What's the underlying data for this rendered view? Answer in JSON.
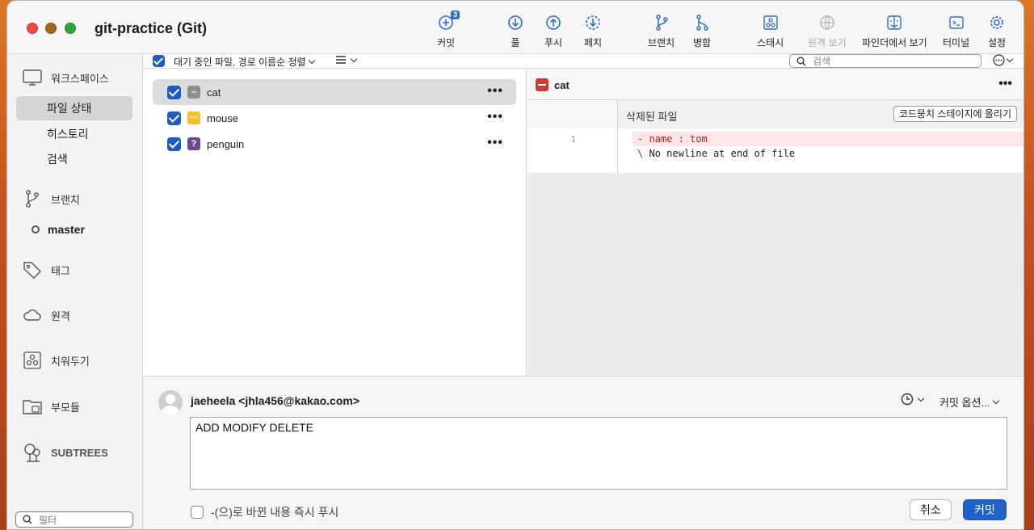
{
  "window": {
    "title": "git-practice (Git)"
  },
  "toolbar": {
    "commit": {
      "label": "커밋",
      "badge": "3"
    },
    "pull": {
      "label": "풀"
    },
    "push": {
      "label": "푸시"
    },
    "fetch": {
      "label": "페치"
    },
    "branch": {
      "label": "브랜치"
    },
    "merge": {
      "label": "병합"
    },
    "stash": {
      "label": "스태시"
    },
    "remote_view": {
      "label": "원격 보기",
      "disabled": true
    },
    "finder": {
      "label": "파인더에서 보기"
    },
    "terminal": {
      "label": "터미널"
    },
    "settings": {
      "label": "설정"
    }
  },
  "sidebar": {
    "workspace": "워크스페이스",
    "file_status": "파일 상태",
    "history": "히스토리",
    "search": "검색",
    "branches": "브랜치",
    "current_branch": "master",
    "tags": "태그",
    "remotes": "원격",
    "stashes": "치워두기",
    "submodules": "부모듈",
    "subtrees": "SUBTREES",
    "filter_placeholder": "필터"
  },
  "filebar": {
    "sort_label": "대기 중인 파일, 경로 이름순 정렬",
    "search_placeholder": "검색"
  },
  "files": [
    {
      "name": "cat",
      "status": "removed",
      "selected": true,
      "checked": true
    },
    {
      "name": "mouse",
      "status": "modified",
      "selected": false,
      "checked": true
    },
    {
      "name": "penguin",
      "status": "untracked",
      "selected": false,
      "checked": true
    }
  ],
  "diff": {
    "file": "cat",
    "hunk_title": "삭제된 파일",
    "stage_button": "코드뭉치 스테이지에 올리기",
    "lines": [
      {
        "num": "1",
        "prefix": "-",
        "text": "name : tom",
        "type": "del"
      },
      {
        "num": "",
        "prefix": "\\",
        "text": "No newline at end of file",
        "type": "note"
      }
    ]
  },
  "commit": {
    "author": "jaeheela <jhla456@kakao.com>",
    "options_label": "커밋 옵션...",
    "message": "ADD MODIFY DELETE",
    "push_option": "-(으)로 바뀐 내용 즉시 푸시",
    "cancel": "취소",
    "submit": "커밋"
  },
  "colors": {
    "accent": "#1f62c9",
    "removed": "#d13a31",
    "modified": "#f2c032",
    "untracked": "#6b4a8e",
    "desktop": "#c4531e"
  }
}
